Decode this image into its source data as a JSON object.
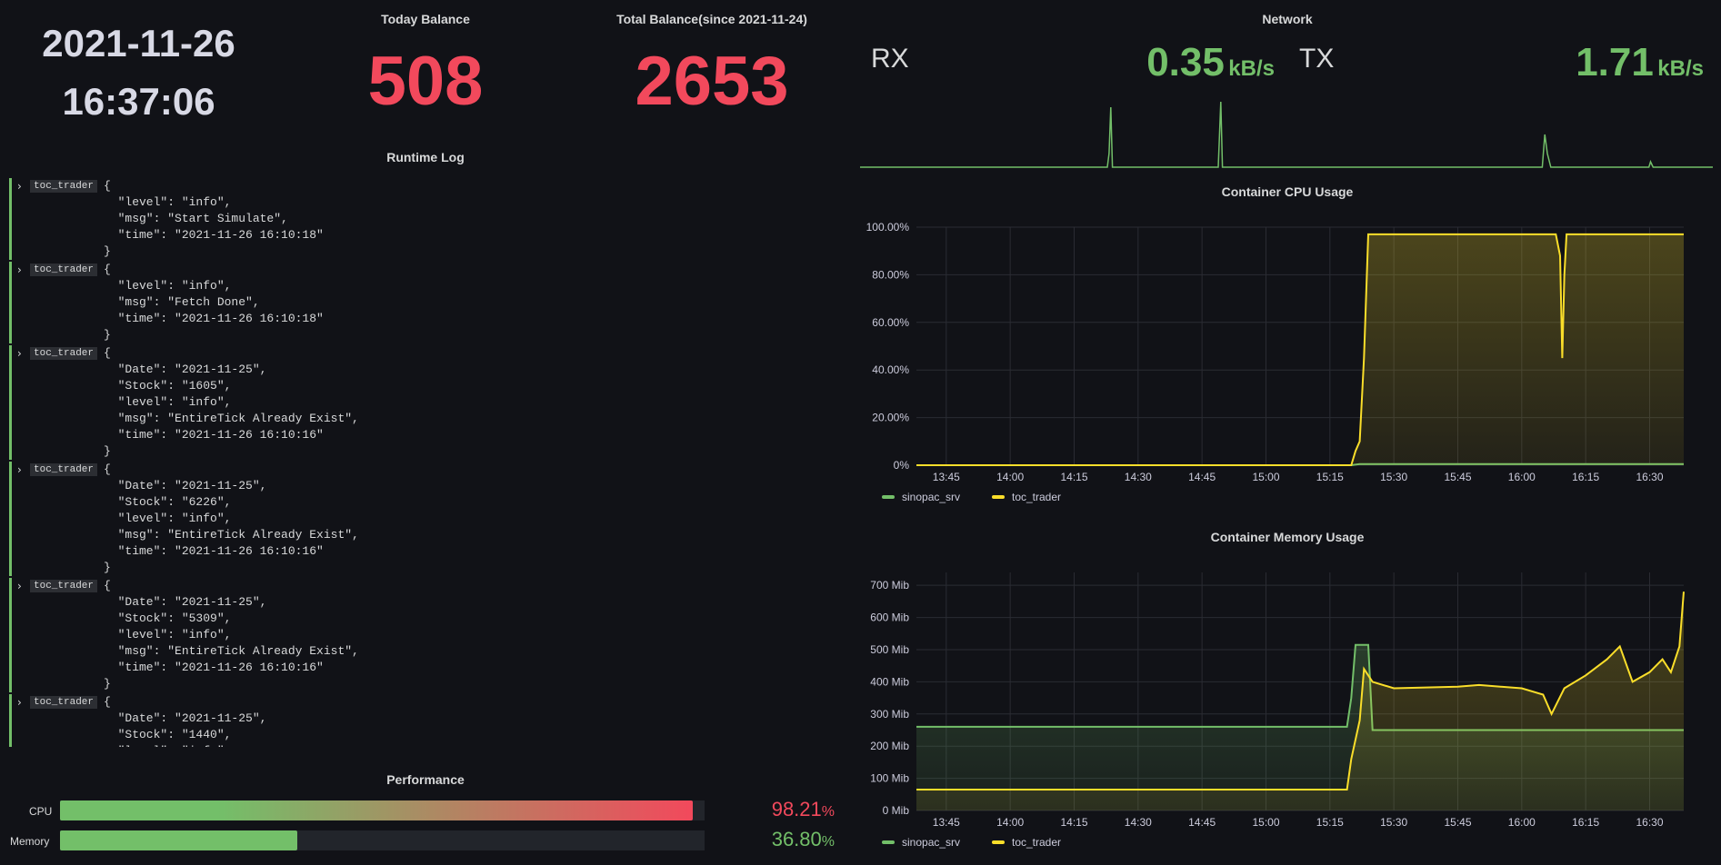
{
  "clock": {
    "date": "2021-11-26",
    "time": "16:37:06"
  },
  "today_balance": {
    "title": "Today Balance",
    "value": "508"
  },
  "total_balance": {
    "title": "Total Balance(since 2021-11-24)",
    "value": "2653"
  },
  "network": {
    "title": "Network",
    "rx": {
      "label": "RX",
      "value": "0.35",
      "unit": "kB/s"
    },
    "tx": {
      "label": "TX",
      "value": "1.71",
      "unit": "kB/s"
    }
  },
  "runtime_log": {
    "title": "Runtime Log",
    "entries": [
      {
        "tag": "toc_trader",
        "text": "{\n  \"level\": \"info\",\n  \"msg\": \"Start Simulate\",\n  \"time\": \"2021-11-26 16:10:18\"\n}"
      },
      {
        "tag": "toc_trader",
        "text": "{\n  \"level\": \"info\",\n  \"msg\": \"Fetch Done\",\n  \"time\": \"2021-11-26 16:10:18\"\n}"
      },
      {
        "tag": "toc_trader",
        "text": "{\n  \"Date\": \"2021-11-25\",\n  \"Stock\": \"1605\",\n  \"level\": \"info\",\n  \"msg\": \"EntireTick Already Exist\",\n  \"time\": \"2021-11-26 16:10:16\"\n}"
      },
      {
        "tag": "toc_trader",
        "text": "{\n  \"Date\": \"2021-11-25\",\n  \"Stock\": \"6226\",\n  \"level\": \"info\",\n  \"msg\": \"EntireTick Already Exist\",\n  \"time\": \"2021-11-26 16:10:16\"\n}"
      },
      {
        "tag": "toc_trader",
        "text": "{\n  \"Date\": \"2021-11-25\",\n  \"Stock\": \"5309\",\n  \"level\": \"info\",\n  \"msg\": \"EntireTick Already Exist\",\n  \"time\": \"2021-11-26 16:10:16\"\n}"
      },
      {
        "tag": "toc_trader",
        "text": "{\n  \"Date\": \"2021-11-25\",\n  \"Stock\": \"1440\",\n  \"level\": \"info\","
      }
    ]
  },
  "performance": {
    "title": "Performance",
    "cpu": {
      "label": "CPU",
      "value": "98.21",
      "unit": "%",
      "fraction": 0.9821
    },
    "memory": {
      "label": "Memory",
      "value": "36.80",
      "unit": "%",
      "fraction": 0.368
    }
  },
  "colors": {
    "green": "#73bf69",
    "red": "#f2495c",
    "yellow": "#fade2a",
    "background": "#111217"
  },
  "chart_data": [
    {
      "type": "area",
      "title": "Container CPU Usage",
      "x_ticks": [
        "13:45",
        "14:00",
        "14:15",
        "14:30",
        "14:45",
        "15:00",
        "15:15",
        "15:30",
        "15:45",
        "16:00",
        "16:15",
        "16:30"
      ],
      "y_ticks": [
        "0%",
        "20.00%",
        "40.00%",
        "60.00%",
        "80.00%",
        "100.00%"
      ],
      "ylim": [
        0,
        100
      ],
      "grid": true,
      "legend_position": "bottom-left",
      "series": [
        {
          "name": "sinopac_srv",
          "color": "#73bf69",
          "points": [
            [
              "13:38",
              0
            ],
            [
              "15:20",
              0
            ],
            [
              "15:22",
              0.5
            ],
            [
              "16:38",
              0.5
            ]
          ]
        },
        {
          "name": "toc_trader",
          "color": "#fade2a",
          "points": [
            [
              "13:38",
              0
            ],
            [
              "15:20",
              0
            ],
            [
              "15:21",
              6
            ],
            [
              "15:22",
              10
            ],
            [
              "15:23",
              45
            ],
            [
              "15:24",
              97
            ],
            [
              "15:40",
              97
            ],
            [
              "16:00",
              97
            ],
            [
              "16:08",
              97
            ],
            [
              "16:09",
              88
            ],
            [
              "16:09.5",
              45
            ],
            [
              "16:10",
              80
            ],
            [
              "16:10.5",
              97
            ],
            [
              "16:38",
              97
            ]
          ]
        }
      ]
    },
    {
      "type": "area",
      "title": "Container Memory Usage",
      "x_ticks": [
        "13:45",
        "14:00",
        "14:15",
        "14:30",
        "14:45",
        "15:00",
        "15:15",
        "15:30",
        "15:45",
        "16:00",
        "16:15",
        "16:30"
      ],
      "y_ticks": [
        "0 Mib",
        "100 Mib",
        "200 Mib",
        "300 Mib",
        "400 Mib",
        "500 Mib",
        "600 Mib",
        "700 Mib"
      ],
      "ylim": [
        0,
        740
      ],
      "grid": true,
      "legend_position": "bottom-left",
      "series": [
        {
          "name": "sinopac_srv",
          "color": "#73bf69",
          "points": [
            [
              "13:38",
              260
            ],
            [
              "15:19",
              260
            ],
            [
              "15:20",
              350
            ],
            [
              "15:21",
              515
            ],
            [
              "15:24",
              515
            ],
            [
              "15:25",
              250
            ],
            [
              "16:38",
              250
            ]
          ]
        },
        {
          "name": "toc_trader",
          "color": "#fade2a",
          "points": [
            [
              "13:38",
              65
            ],
            [
              "15:19",
              65
            ],
            [
              "15:20",
              160
            ],
            [
              "15:22",
              280
            ],
            [
              "15:23",
              440
            ],
            [
              "15:25",
              400
            ],
            [
              "15:30",
              380
            ],
            [
              "15:45",
              385
            ],
            [
              "15:50",
              390
            ],
            [
              "16:00",
              380
            ],
            [
              "16:05",
              360
            ],
            [
              "16:07",
              300
            ],
            [
              "16:10",
              380
            ],
            [
              "16:15",
              420
            ],
            [
              "16:20",
              470
            ],
            [
              "16:23",
              510
            ],
            [
              "16:26",
              400
            ],
            [
              "16:30",
              430
            ],
            [
              "16:33",
              470
            ],
            [
              "16:35",
              430
            ],
            [
              "16:37",
              510
            ],
            [
              "16:38",
              680
            ]
          ]
        }
      ]
    },
    {
      "type": "line",
      "title": "Network",
      "series": [
        {
          "name": "RX",
          "color": "#73bf69",
          "points": [
            [
              0,
              0
            ],
            [
              0.29,
              0
            ],
            [
              0.292,
              5
            ],
            [
              0.294,
              22
            ],
            [
              0.296,
              0
            ],
            [
              0.42,
              0
            ],
            [
              0.423,
              24
            ],
            [
              0.425,
              0
            ],
            [
              0.8,
              0
            ],
            [
              0.803,
              12
            ],
            [
              0.806,
              5
            ],
            [
              0.81,
              0
            ],
            [
              0.925,
              0
            ],
            [
              0.927,
              2
            ],
            [
              0.93,
              0
            ],
            [
              1,
              0
            ]
          ]
        }
      ]
    }
  ]
}
